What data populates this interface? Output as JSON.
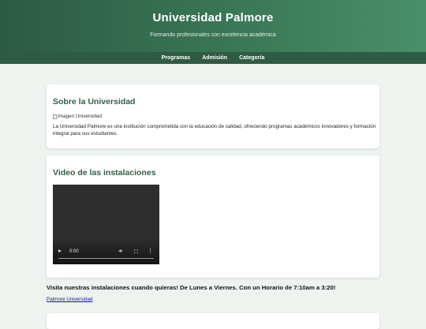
{
  "header": {
    "title": "Universidad Palmore",
    "subtitle": "Formando profesionales con excelencia académica"
  },
  "nav": {
    "items": [
      "Programas",
      "Admisión",
      "Categoría"
    ]
  },
  "about": {
    "title": "Sobre la Universidad",
    "image_alt": "Imagen Universidad",
    "description": "La Universidad Palmore es una institución comprometida con la educación de calidad, ofreciendo programas académicos innovadores y formación integral para sus estudiantes."
  },
  "video_section": {
    "title": "Video de las instalaciones",
    "player": {
      "time": "0:00"
    }
  },
  "visit": {
    "text": "Visita nuestras instalaciones cuando quieras! De Lunes a Viernes. Con un Horario de 7:10am a 3:20!",
    "link_label": "Palmore Universidad"
  },
  "colors": {
    "header_gradient_start": "#2c5a45",
    "header_gradient_end": "#4a8f69",
    "nav_bg": "#2f5b44",
    "section_title": "#2f5f48",
    "page_bg": "#eef3f0"
  }
}
